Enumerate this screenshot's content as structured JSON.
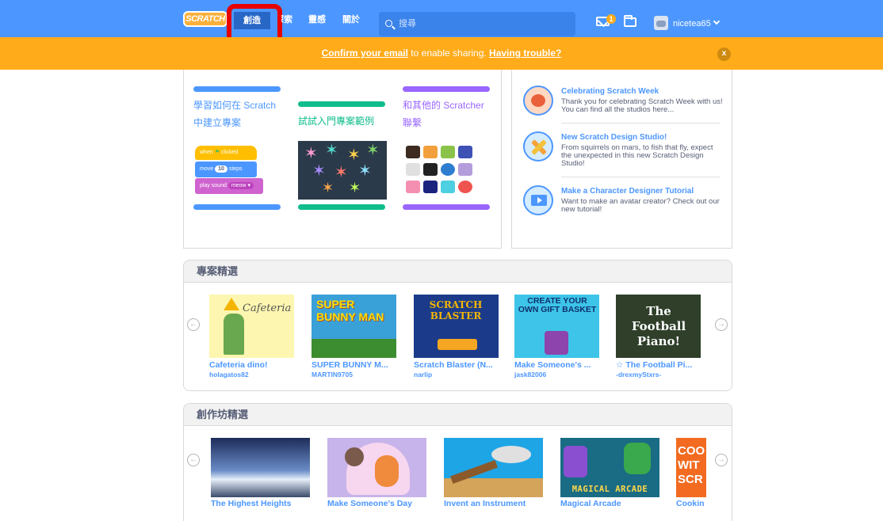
{
  "nav": {
    "logo": "SCRATCH",
    "create": "創造",
    "explore": "探索",
    "ideas": "靈感",
    "about": "關於",
    "search_placeholder": "搜尋",
    "messages_count": "1",
    "username": "nicetea65"
  },
  "banner": {
    "confirm_link": "Confirm your email",
    "middle_text": " to enable sharing. ",
    "trouble_link": "Having trouble?",
    "close": "x"
  },
  "tutorials": [
    {
      "label_line1": "學習如何在 Scratch",
      "label_line2": "中建立專案",
      "color": "#4c97ff"
    },
    {
      "label_line1": "試試入門專案範例",
      "label_line2": "",
      "color": "#0fbd8c"
    },
    {
      "label_line1": "和其他的 Scratcher",
      "label_line2": "聯繫",
      "color": "#9966ff"
    }
  ],
  "code_blocks": {
    "when": "when",
    "clicked": "clicked",
    "move": "move",
    "steps_value": "10",
    "steps": "steps",
    "play_sound": "play sound",
    "sound_name": "meow"
  },
  "news": [
    {
      "title": "Celebrating Scratch Week",
      "text": "Thank you for celebrating Scratch Week with us! You can find all the studios here..."
    },
    {
      "title": "New Scratch Design Studio!",
      "text": "From squirrels on mars, to fish that fly, expect the unexpected in this new Scratch Design Studio!"
    },
    {
      "title": "Make a Character Designer Tutorial",
      "text": "Want to make an avatar creator? Check out our new tutorial!"
    }
  ],
  "featured_projects": {
    "heading": "專案精選",
    "items": [
      {
        "title": "Cafeteria dino!",
        "author": "holagatos82",
        "thumb_text": "Cafeteria",
        "color": "#fdf6b0"
      },
      {
        "title": "SUPER BUNNY M...",
        "author": "MARTIN9705",
        "thumb_text": "SUPER BUNNY MAN",
        "color": "#3aa0d8"
      },
      {
        "title": "Scratch Blaster (N...",
        "author": "narlip",
        "thumb_text": "SCRATCH BLASTER",
        "color": "#1b3b8a"
      },
      {
        "title": "Make Someone's ...",
        "author": "jask82006",
        "thumb_text": "CREATE YOUR OWN GIFT BASKET",
        "color": "#3dc4e8"
      },
      {
        "title": "☆ The Football Pi...",
        "author": "-drexmyStxrs-",
        "thumb_text": "The Football Piano!",
        "color": "#2f3f2a"
      }
    ]
  },
  "featured_studios": {
    "heading": "創作坊精選",
    "items": [
      {
        "title": "The Highest Heights",
        "color": "#1d2c5a"
      },
      {
        "title": "Make Someone's Day",
        "color": "#c7b4ea"
      },
      {
        "title": "Invent an Instrument",
        "color": "#1ea5e6"
      },
      {
        "title": "Magical Arcade",
        "color": "#1a6b84"
      },
      {
        "title": "Cookin",
        "thumb_text": "COO WIT SCR",
        "color": "#f26b21"
      }
    ]
  }
}
